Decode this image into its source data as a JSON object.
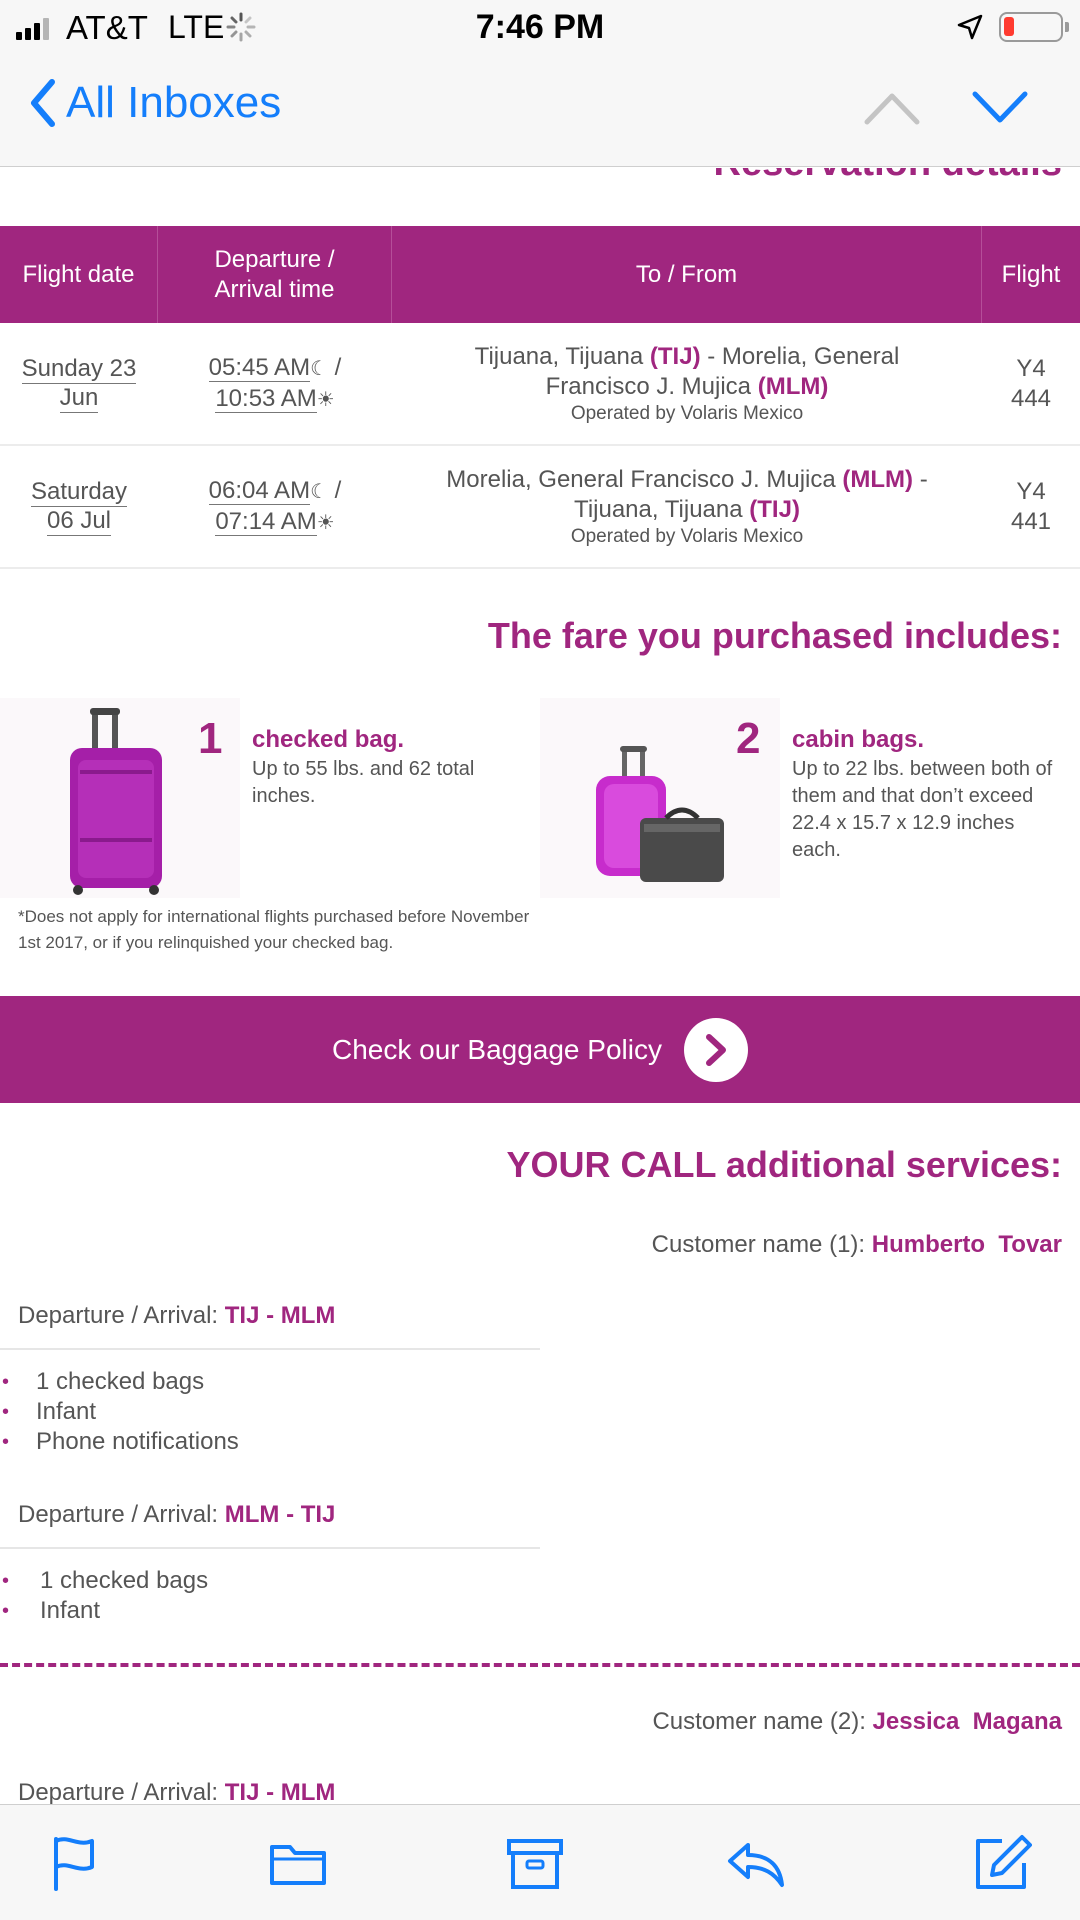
{
  "status_bar": {
    "carrier": "AT&T",
    "network": "LTE",
    "time": "7:46 PM",
    "battery_color": "#ff3b30"
  },
  "nav": {
    "back_label": "All Inboxes"
  },
  "email": {
    "partial_heading": "Reservation details",
    "accent_color": "#a0267f",
    "table": {
      "headers": [
        "Flight date",
        "Departure / Arrival time",
        "To / From",
        "Flight"
      ],
      "rows": [
        {
          "date_line1": "Sunday 23",
          "date_line2": "Jun",
          "departure": "05:45 AM",
          "arrival": "10:53 AM",
          "route_from": "Tijuana, Tijuana",
          "route_from_code": "(TIJ)",
          "route_to": "Morelia, General Francisco J. Mujica",
          "route_to_code": "(MLM)",
          "operated_by": "Operated by Volaris Mexico",
          "flight_line1": "Y4",
          "flight_line2": "444"
        },
        {
          "date_line1": "Saturday",
          "date_line2": "06 Jul",
          "departure": "06:04 AM",
          "arrival": "07:14 AM",
          "route_from": "Morelia, General Francisco J. Mujica",
          "route_from_code": "(MLM)",
          "route_to": "Tijuana, Tijuana",
          "route_to_code": "(TIJ)",
          "operated_by": "Operated by Volaris Mexico",
          "flight_line1": "Y4",
          "flight_line2": "441"
        }
      ]
    },
    "fare_heading": "The fare you purchased includes:",
    "bags": [
      {
        "count": "1",
        "title": "checked bag.",
        "description": "Up to 55 lbs. and 62 total inches."
      },
      {
        "count": "2",
        "title": "cabin bags.",
        "description": "Up to 22 lbs. between both of them and that don’t exceed 22.4 x 15.7 x 12.9 inches each."
      }
    ],
    "disclaimer": "*Does not apply for international flights purchased before November 1st 2017, or if you relinquished your checked bag.",
    "baggage_button": "Check our Baggage Policy",
    "services_heading": "YOUR CALL additional services:",
    "customers": [
      {
        "label": "Customer name (1):",
        "name": "Humberto  Tovar",
        "legs": [
          {
            "label": "Departure / Arrival:",
            "route": "TIJ - MLM",
            "services": [
              "1 checked bags",
              "Infant",
              "Phone notifications"
            ]
          },
          {
            "label": "Departure / Arrival:",
            "route": "MLM - TIJ",
            "services": [
              "1 checked bags",
              "Infant"
            ]
          }
        ]
      },
      {
        "label": "Customer name (2):",
        "name": "Jessica  Magana",
        "legs": [
          {
            "label": "Departure / Arrival:",
            "route": "TIJ - MLM"
          }
        ]
      }
    ]
  },
  "toolbar": {
    "icons": [
      "flag-icon",
      "folder-icon",
      "archive-icon",
      "reply-icon",
      "compose-icon"
    ],
    "icon_color": "#147efb"
  }
}
